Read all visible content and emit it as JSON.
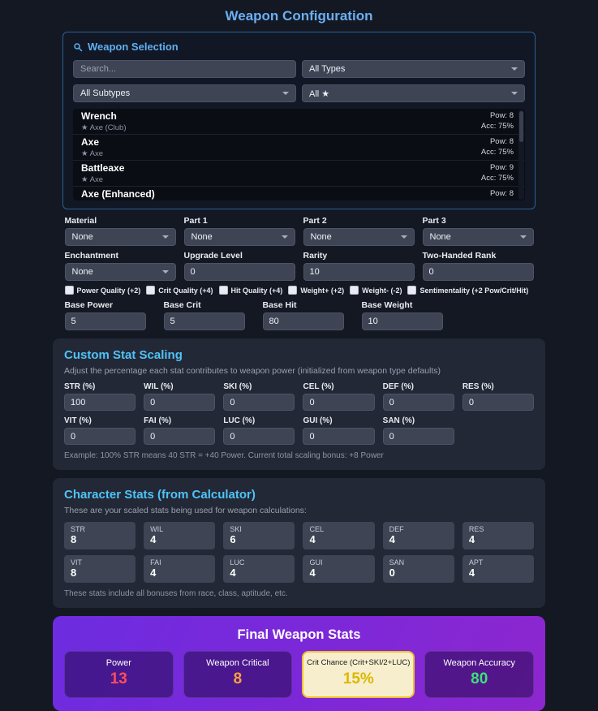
{
  "page_title": "Weapon Configuration",
  "colors": {
    "accent_blue": "#6aaff5",
    "section_cyan": "#4fc3f7",
    "power_red": "#ff4d5e",
    "crit_orange": "#ffa040",
    "crit_chance_yellow": "#dcb800",
    "accuracy_green": "#3ce07a",
    "highlight_border": "#f0c02e",
    "panel_purple_start": "#6d2ce0",
    "panel_purple_end": "#8e27cf"
  },
  "weapon_selection": {
    "title": "Weapon Selection",
    "search_placeholder": "Search...",
    "filters": {
      "type": "All Types",
      "subtype": "All Subtypes",
      "star": "All ★"
    },
    "weapons": [
      {
        "name": "Wrench",
        "subtype": "★ Axe (Club)",
        "pow": "Pow: 8",
        "acc": "Acc: 75%"
      },
      {
        "name": "Axe",
        "subtype": "★ Axe",
        "pow": "Pow: 8",
        "acc": "Acc: 75%"
      },
      {
        "name": "Battleaxe",
        "subtype": "★ Axe",
        "pow": "Pow: 9",
        "acc": "Acc: 75%"
      },
      {
        "name": "Axe (Enhanced)",
        "subtype": "",
        "pow": "Pow: 8",
        "acc": ""
      }
    ]
  },
  "config": {
    "row1": [
      {
        "label": "Material",
        "value": "None"
      },
      {
        "label": "Part 1",
        "value": "None"
      },
      {
        "label": "Part 2",
        "value": "None"
      },
      {
        "label": "Part 3",
        "value": "None"
      }
    ],
    "row2": [
      {
        "label": "Enchantment",
        "value": "None"
      },
      {
        "label": "Upgrade Level",
        "value": "0"
      },
      {
        "label": "Rarity",
        "value": "10"
      },
      {
        "label": "Two-Handed Rank",
        "value": "0"
      }
    ],
    "checkboxes": [
      {
        "label": "Power Quality (+2)"
      },
      {
        "label": "Crit Quality (+4)"
      },
      {
        "label": "Hit Quality (+4)"
      },
      {
        "label": "Weight+ (+2)"
      },
      {
        "label": "Weight- (-2)"
      },
      {
        "label": "Sentimentality (+2 Pow/Crit/Hit)"
      }
    ],
    "base": [
      {
        "label": "Base Power",
        "value": "5"
      },
      {
        "label": "Base Crit",
        "value": "5"
      },
      {
        "label": "Base Hit",
        "value": "80"
      },
      {
        "label": "Base Weight",
        "value": "10"
      }
    ]
  },
  "stat_scaling": {
    "title": "Custom Stat Scaling",
    "subtitle": "Adjust the percentage each stat contributes to weapon power (initialized from weapon type defaults)",
    "row1": [
      {
        "label": "STR (%)",
        "value": "100"
      },
      {
        "label": "WIL (%)",
        "value": "0"
      },
      {
        "label": "SKI (%)",
        "value": "0"
      },
      {
        "label": "CEL (%)",
        "value": "0"
      },
      {
        "label": "DEF (%)",
        "value": "0"
      },
      {
        "label": "RES (%)",
        "value": "0"
      }
    ],
    "row2": [
      {
        "label": "VIT (%)",
        "value": "0"
      },
      {
        "label": "FAI (%)",
        "value": "0"
      },
      {
        "label": "LUC (%)",
        "value": "0"
      },
      {
        "label": "GUI (%)",
        "value": "0"
      },
      {
        "label": "SAN (%)",
        "value": "0"
      }
    ],
    "footer": "Example: 100% STR means 40 STR = +40 Power. Current total scaling bonus: +8 Power"
  },
  "character_stats": {
    "title": "Character Stats (from Calculator)",
    "subtitle": "These are your scaled stats being used for weapon calculations:",
    "stats": [
      {
        "label": "STR",
        "value": "8"
      },
      {
        "label": "WIL",
        "value": "4"
      },
      {
        "label": "SKI",
        "value": "6"
      },
      {
        "label": "CEL",
        "value": "4"
      },
      {
        "label": "DEF",
        "value": "4"
      },
      {
        "label": "RES",
        "value": "4"
      },
      {
        "label": "VIT",
        "value": "8"
      },
      {
        "label": "FAI",
        "value": "4"
      },
      {
        "label": "LUC",
        "value": "4"
      },
      {
        "label": "GUI",
        "value": "4"
      },
      {
        "label": "SAN",
        "value": "0"
      },
      {
        "label": "APT",
        "value": "4"
      }
    ],
    "footer": "These stats include all bonuses from race, class, aptitude, etc."
  },
  "final_stats": {
    "title": "Final Weapon Stats",
    "cards": [
      {
        "label": "Power",
        "value": "13"
      },
      {
        "label": "Weapon Critical",
        "value": "8"
      },
      {
        "label": "Crit Chance (Crit+SKI/2+LUC)",
        "value": "15%"
      },
      {
        "label": "Weapon Accuracy",
        "value": "80"
      }
    ]
  }
}
